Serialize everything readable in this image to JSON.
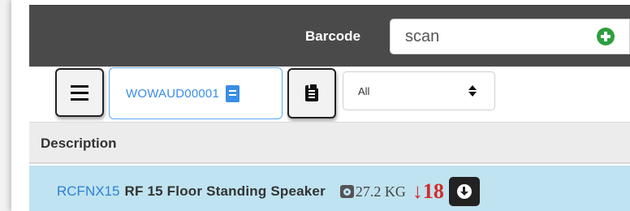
{
  "header": {
    "barcode_label": "Barcode",
    "barcode_placeholder": "scan",
    "add_icon": "plus-circle-icon",
    "add_icon_color": "#2e9e3e",
    "background": "#4a4a4a"
  },
  "toolbar": {
    "menu_icon": "hamburger-menu-icon",
    "audit_code": "WOWAUD00001",
    "audit_icon": "book-icon",
    "clipboard_icon": "clipboard-icon",
    "filter_selected": "All",
    "accent_color": "#3a8ee6"
  },
  "table": {
    "columns": [
      "Description"
    ],
    "rows": [
      {
        "sku": "RCFNX15",
        "description": "RF 15 Floor Standing Speaker",
        "weight_icon": "weight-icon",
        "weight": "27.2 KG",
        "trend_symbol": "↓",
        "quantity": "18",
        "quantity_color": "#d42a2a",
        "action_icon": "download-icon",
        "row_color": "#bfe3f0"
      }
    ]
  }
}
